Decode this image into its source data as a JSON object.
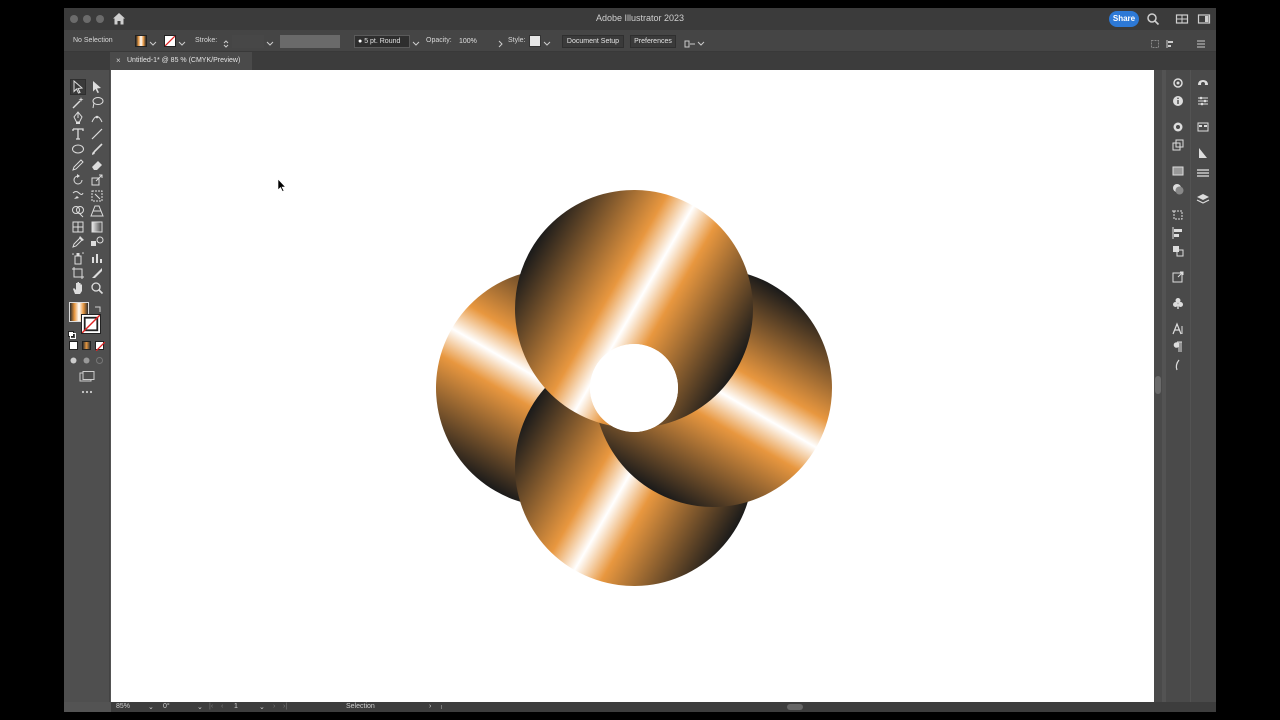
{
  "window": {
    "title": "Adobe Illustrator 2023",
    "share_label": "Share",
    "icons": [
      "home-icon",
      "search-icon",
      "workspace-icon",
      "panel-toggle-icon"
    ]
  },
  "control_bar": {
    "selection_label": "No Selection",
    "stroke_label": "Stroke:",
    "brush_value": "5 pt. Round",
    "opacity_label": "Opacity:",
    "opacity_value": "100%",
    "style_label": "Style:",
    "document_setup_label": "Document Setup",
    "preferences_label": "Preferences"
  },
  "document_tab": {
    "close_glyph": "×",
    "label": "Untitled-1* @ 85 % (CMYK/Preview)"
  },
  "tools": [
    "selection-tool",
    "direct-selection-tool",
    "magic-wand-tool",
    "lasso-tool",
    "pen-tool",
    "curvature-tool",
    "type-tool",
    "line-segment-tool",
    "ellipse-tool",
    "paintbrush-tool",
    "pencil-tool",
    "eraser-tool",
    "rotate-tool",
    "scale-tool",
    "warp-tool",
    "free-transform-tool",
    "shape-builder-tool",
    "perspective-grid-tool",
    "mesh-tool",
    "gradient-tool",
    "eyedropper-tool",
    "blend-tool",
    "symbol-sprayer-tool",
    "column-graph-tool",
    "artboard-tool",
    "slice-tool",
    "hand-tool",
    "zoom-tool"
  ],
  "artwork": {
    "gradient_colors": [
      "#1a1a1a",
      "#e8973f",
      "#ffffff",
      "#e8973f",
      "#1a1a1a"
    ],
    "description_colors": {
      "dark": "#1a1a1a",
      "orange": "#e8973f",
      "highlight": "#ffffff"
    }
  },
  "status_bar": {
    "zoom": "85%",
    "rotation": "0°",
    "artboard": "1",
    "tool_name": "Selection"
  },
  "colors": {
    "accent": "#2d79d6",
    "chrome": "#535353",
    "panel": "#4a4a4a"
  }
}
